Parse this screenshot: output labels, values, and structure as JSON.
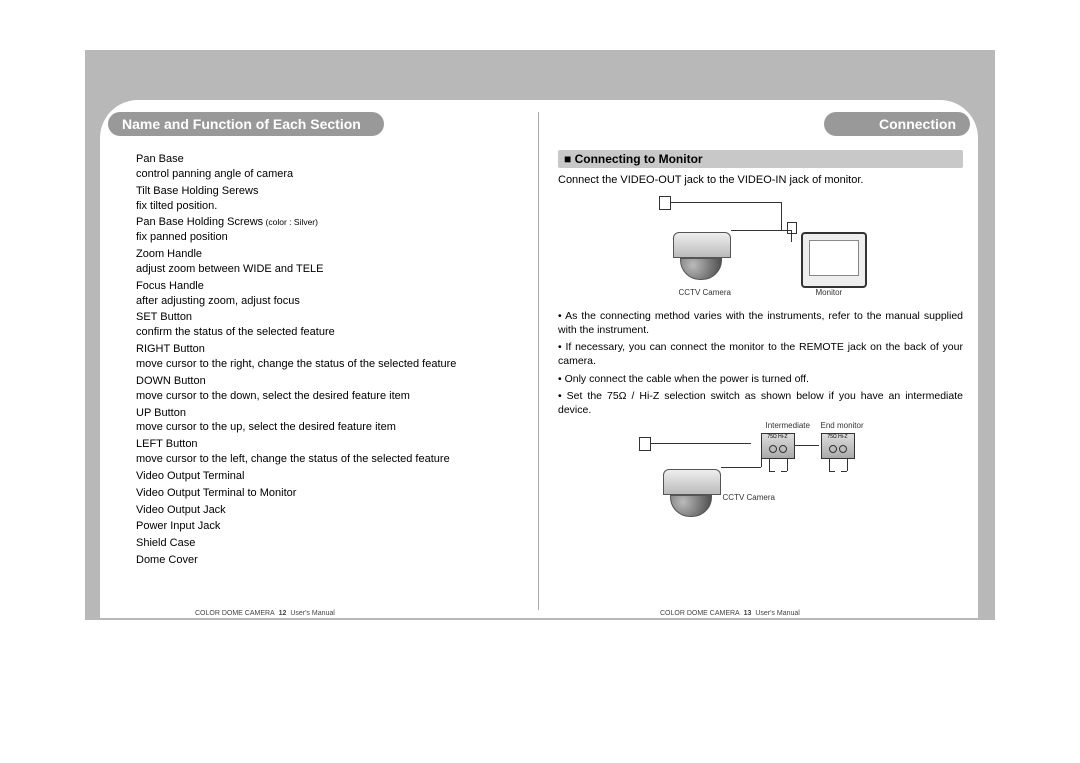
{
  "headers": {
    "left": "Name and Function of Each Section",
    "right": "Connection"
  },
  "leftItems": [
    {
      "term": "Pan Base",
      "desc": "control panning angle of camera"
    },
    {
      "term": "Tilt Base Holding Serews",
      "desc": "fix tilted position."
    },
    {
      "term": "Pan Base Holding Screws",
      "note": "(color : Silver)",
      "desc": "fix panned position"
    },
    {
      "term": "Zoom Handle",
      "desc": "adjust zoom between WIDE and TELE"
    },
    {
      "term": "Focus Handle",
      "desc": "after adjusting zoom, adjust focus"
    },
    {
      "term": "SET Button",
      "desc": "confirm the status of the selected feature"
    },
    {
      "term": "RIGHT Button",
      "desc": "move cursor to the right, change the status of the selected feature"
    },
    {
      "term": "DOWN Button",
      "desc": "move cursor to the down, select the desired feature item"
    },
    {
      "term": "UP Button",
      "desc": "move cursor to the up, select the desired feature item"
    },
    {
      "term": "LEFT Button",
      "desc": "move cursor to the left, change the status of the selected feature"
    },
    {
      "term": "Video Output Terminal",
      "desc": ""
    },
    {
      "term": "Video Output Terminal to Monitor",
      "desc": ""
    },
    {
      "term": "Video Output Jack",
      "desc": ""
    },
    {
      "term": "Power Input Jack",
      "desc": ""
    },
    {
      "term": "Shield Case",
      "desc": ""
    },
    {
      "term": "Dome Cover",
      "desc": ""
    }
  ],
  "right": {
    "subheader": "Connecting to Monitor",
    "intro": "Connect the VIDEO-OUT jack to the VIDEO-IN jack of monitor.",
    "labels": {
      "cctv": "CCTV Camera",
      "monitor": "Monitor",
      "intermediate": "Intermediate",
      "endMonitor": "End monitor"
    },
    "notes": [
      "As the connecting method varies with the instruments, refer to the manual supplied with the instrument.",
      "If necessary, you can connect the monitor to the REMOTE jack on the back of your camera.",
      "Only connect the cable when the power is turned off.",
      "Set the 75Ω / Hi-Z selection switch as shown below if you have an intermediate device."
    ]
  },
  "footer": {
    "product": "COLOR DOME CAMERA",
    "pageLeft": "12",
    "pageRight": "13",
    "suffix": "User's Manual"
  }
}
